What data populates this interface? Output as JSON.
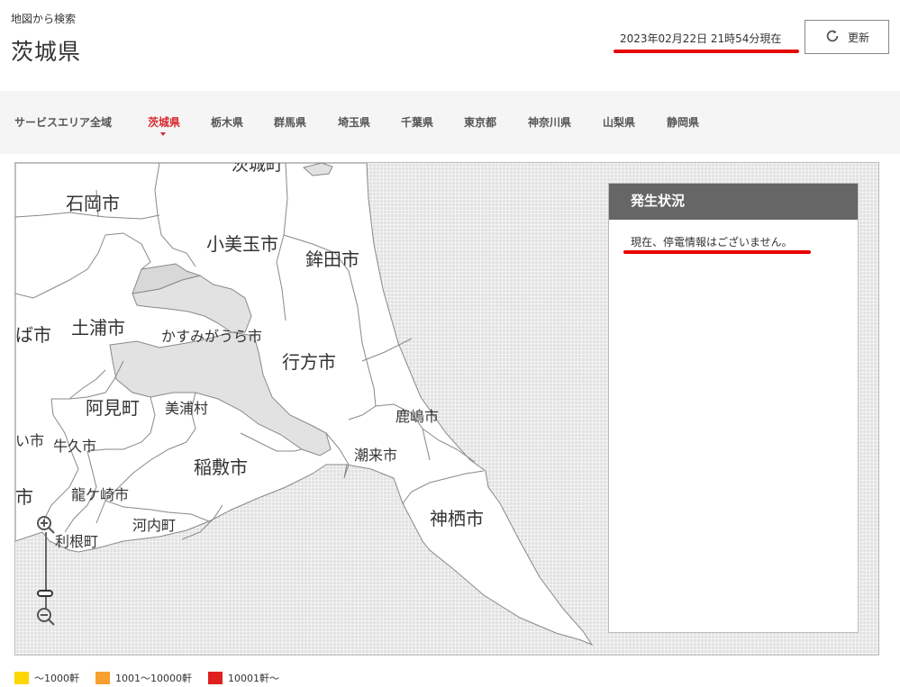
{
  "header": {
    "subtitle": "地図から検索",
    "title": "茨城県",
    "timestamp": "2023年02月22日 21時54分現在",
    "refresh_label": "更新"
  },
  "nav": {
    "items": [
      {
        "label": "サービスエリア全域",
        "active": false
      },
      {
        "label": "茨城県",
        "active": true
      },
      {
        "label": "栃木県",
        "active": false
      },
      {
        "label": "群馬県",
        "active": false
      },
      {
        "label": "埼玉県",
        "active": false
      },
      {
        "label": "千葉県",
        "active": false
      },
      {
        "label": "東京都",
        "active": false
      },
      {
        "label": "神奈川県",
        "active": false
      },
      {
        "label": "山梨県",
        "active": false
      },
      {
        "label": "静岡県",
        "active": false
      }
    ]
  },
  "map": {
    "labels": {
      "top_partial": "茨城町",
      "ishioka": "石岡市",
      "omitama": "小美玉市",
      "hokota": "鉾田市",
      "left_partial_1": "ば市",
      "tsuchiura": "土浦市",
      "kasumigaura": "かすみがうら市",
      "namegata": "行方市",
      "ami": "阿見町",
      "miho": "美浦村",
      "kashima": "鹿嶋市",
      "left_partial_2": "い市",
      "ushiku": "牛久市",
      "inashiki": "稲敷市",
      "itako": "潮来市",
      "left_partial_3": "市",
      "ryugasaki": "龍ケ崎市",
      "kamisu": "神栖市",
      "kawachi": "河内町",
      "tone": "利根町"
    }
  },
  "status": {
    "header": "発生状況",
    "message": "現在、停電情報はございません。"
  },
  "legend": [
    {
      "label": "～1000軒",
      "color": "#ffd700"
    },
    {
      "label": "1001～10000軒",
      "color": "#f7a030"
    },
    {
      "label": "10001軒～",
      "color": "#e02020"
    }
  ],
  "colors": {
    "accent_red": "#d6282d",
    "highlight_underline": "#e60000",
    "map_land": "#ffffff",
    "map_water": "#e2e2e2"
  }
}
